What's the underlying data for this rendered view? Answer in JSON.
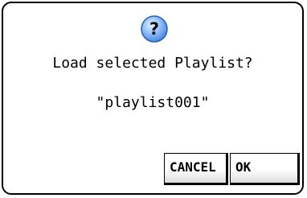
{
  "dialog": {
    "icon": "question-icon",
    "icon_glyph": "?",
    "message": "Load selected Playlist?",
    "playlist_name": "\"playlist001\"",
    "cancel_label": "CANCEL",
    "ok_label": "OK"
  },
  "colors": {
    "icon_fill": "#1e5fd6",
    "icon_glyph": "#ffffff",
    "border": "#000000"
  }
}
